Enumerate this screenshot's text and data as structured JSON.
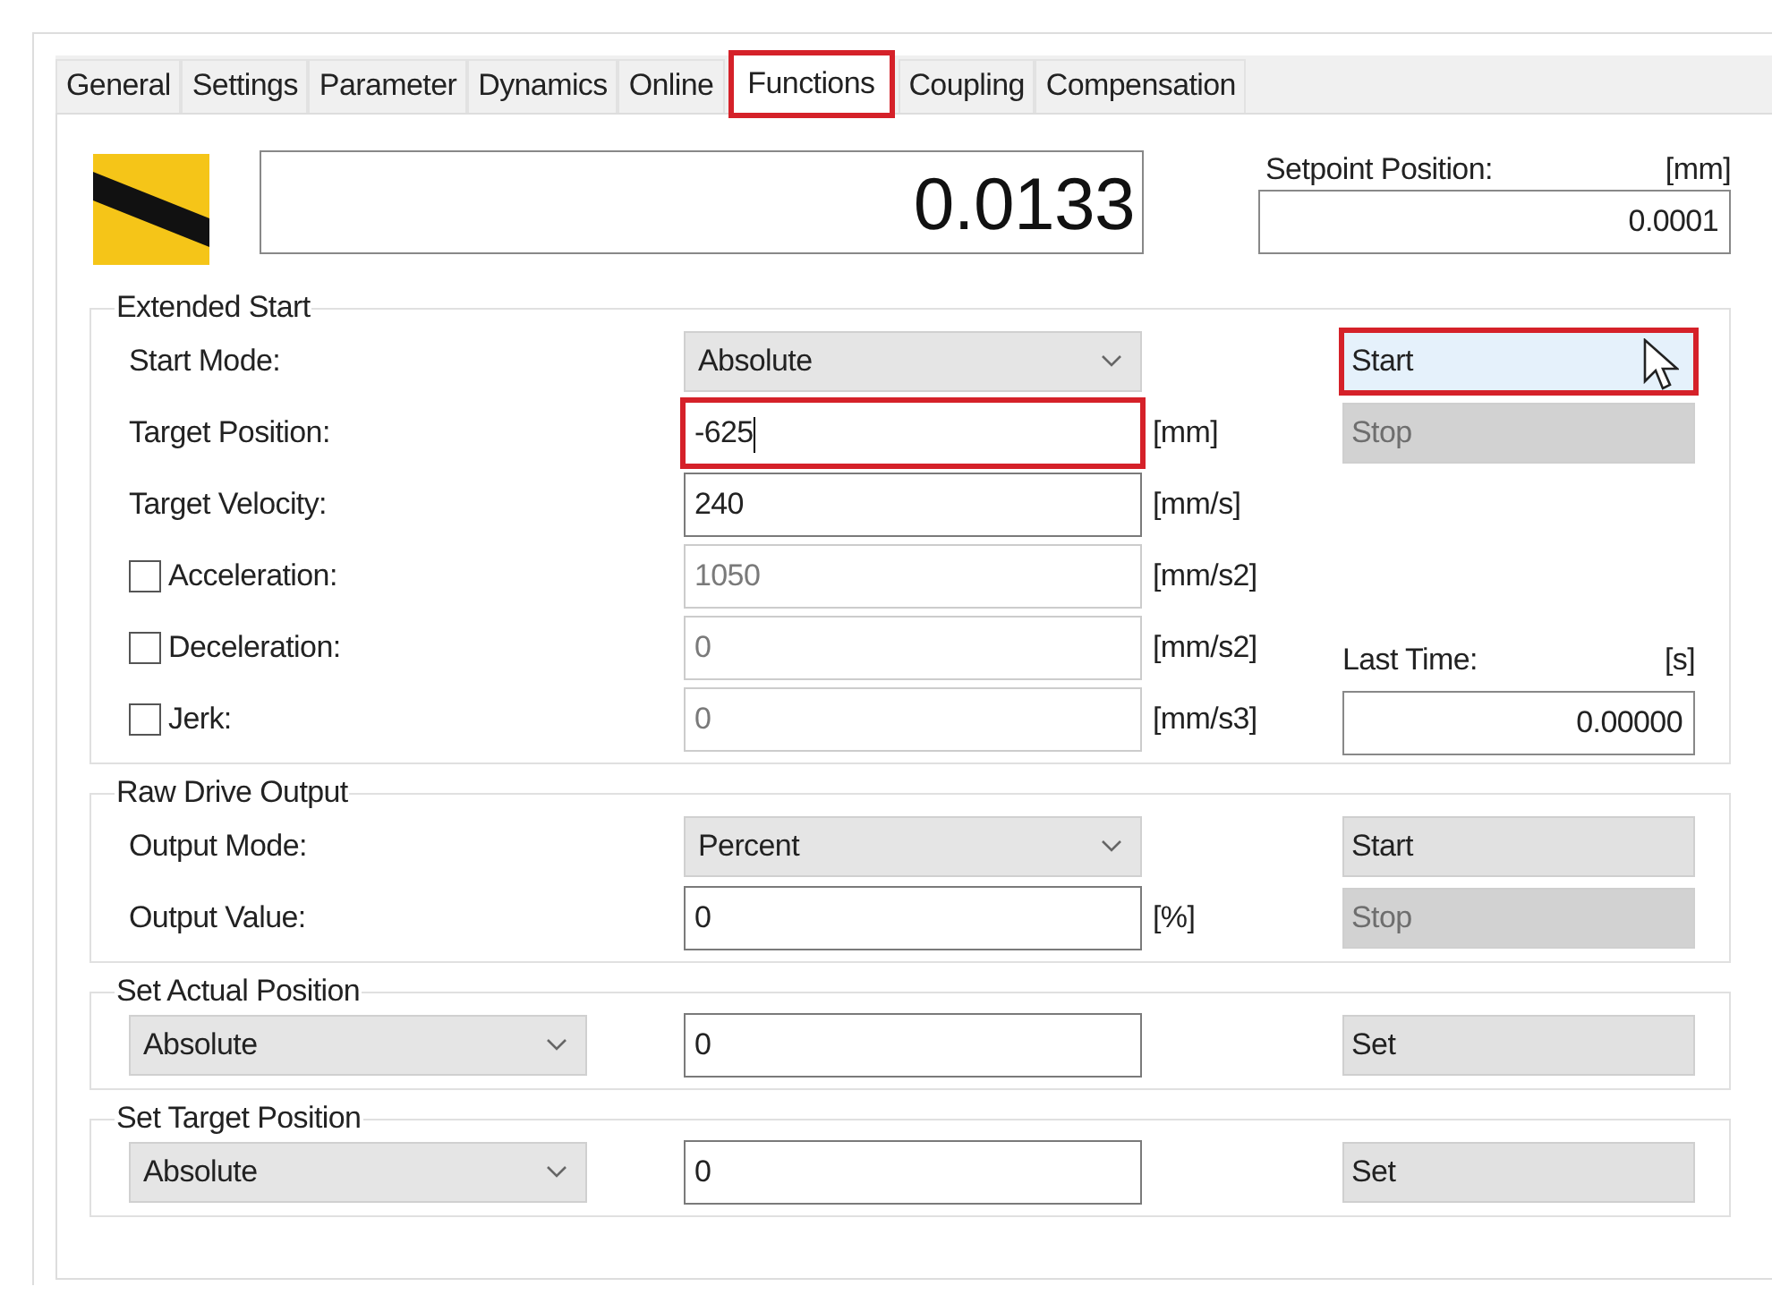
{
  "tabs": [
    {
      "label": "General",
      "selected": false,
      "highlighted": false
    },
    {
      "label": "Settings",
      "selected": false,
      "highlighted": false
    },
    {
      "label": "Parameter",
      "selected": false,
      "highlighted": false
    },
    {
      "label": "Dynamics",
      "selected": false,
      "highlighted": false
    },
    {
      "label": "Online",
      "selected": false,
      "highlighted": false
    },
    {
      "label": "Functions",
      "selected": true,
      "highlighted": true
    },
    {
      "label": "Coupling",
      "selected": false,
      "highlighted": false
    },
    {
      "label": "Compensation",
      "selected": false,
      "highlighted": false
    }
  ],
  "actual_position": {
    "value": "0.0133"
  },
  "setpoint_position": {
    "label": "Setpoint Position:",
    "unit": "[mm]",
    "value": "0.0001"
  },
  "extended_start": {
    "title": "Extended Start",
    "rows": [
      {
        "kind": "dropdown",
        "label": "Start Mode:",
        "value": "Absolute"
      },
      {
        "kind": "field",
        "label": "Target Position:",
        "value": "-625",
        "unit": "[mm]",
        "highlighted": true,
        "focused": true
      },
      {
        "kind": "field",
        "label": "Target Velocity:",
        "value": "240",
        "unit": "[mm/s]"
      },
      {
        "kind": "checkfield",
        "label": "Acceleration:",
        "checked": false,
        "value": "1050",
        "unit": "[mm/s2]",
        "disabled": true
      },
      {
        "kind": "checkfield",
        "label": "Deceleration:",
        "checked": false,
        "value": "0",
        "unit": "[mm/s2]",
        "disabled": true
      },
      {
        "kind": "checkfield",
        "label": "Jerk:",
        "checked": false,
        "value": "0",
        "unit": "[mm/s3]",
        "disabled": true
      }
    ],
    "buttons": [
      {
        "label": "Start",
        "disabled": false,
        "hovered": true,
        "highlighted": true
      },
      {
        "label": "Stop",
        "disabled": true,
        "hovered": false,
        "highlighted": false
      }
    ],
    "last_time": {
      "label": "Last Time:",
      "unit": "[s]",
      "value": "0.00000"
    }
  },
  "raw_drive_output": {
    "title": "Raw Drive Output",
    "rows": [
      {
        "kind": "dropdown",
        "label": "Output Mode:",
        "value": "Percent"
      },
      {
        "kind": "field",
        "label": "Output Value:",
        "value": "0",
        "unit": "[%]"
      }
    ],
    "buttons": [
      {
        "label": "Start",
        "disabled": false,
        "hovered": false,
        "highlighted": false
      },
      {
        "label": "Stop",
        "disabled": true,
        "hovered": false,
        "highlighted": false
      }
    ]
  },
  "set_actual_position": {
    "title": "Set Actual Position",
    "mode": "Absolute",
    "value": "0",
    "button": "Set"
  },
  "set_target_position": {
    "title": "Set Target Position",
    "mode": "Absolute",
    "value": "0",
    "button": "Set"
  }
}
